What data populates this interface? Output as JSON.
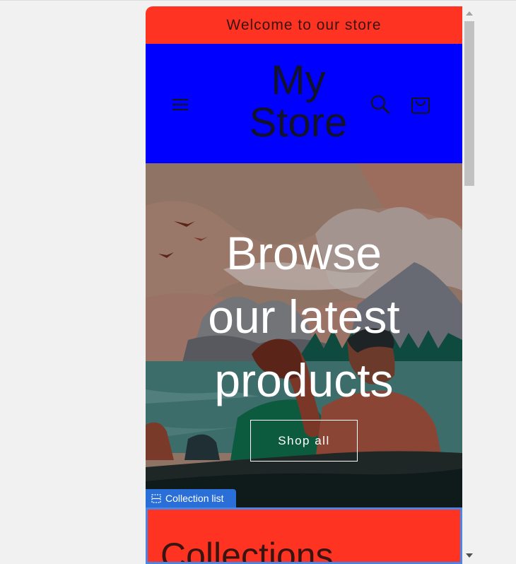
{
  "announcement": {
    "text": "Welcome to our store"
  },
  "header": {
    "store_name_line1": "My",
    "store_name_line2": "Store",
    "icons": [
      "hamburger-menu-icon",
      "search-icon",
      "cart-icon"
    ]
  },
  "hero": {
    "title_line1": "Browse",
    "title_line2": "our latest",
    "title_line3": "products",
    "button_label": "Shop all"
  },
  "section_tag": {
    "label": "Collection list",
    "icon": "section-icon"
  },
  "collections": {
    "heading": "Collections"
  },
  "colors": {
    "announcement_bg": "#ff3322",
    "header_bg": "#0000ff",
    "collections_bg": "#ff3322",
    "section_tag_bg": "#2a6fd8",
    "selection_outline": "#4a86e8"
  }
}
